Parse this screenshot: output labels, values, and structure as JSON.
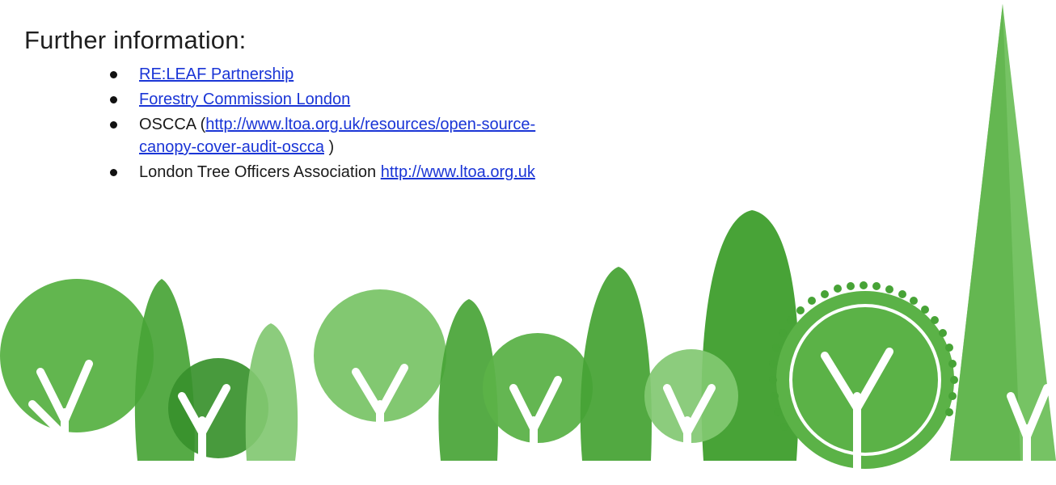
{
  "heading": "Further information:",
  "links": [
    {
      "prefix": "",
      "link": "RE:LEAF Partnership",
      "suffix": ""
    },
    {
      "prefix": "",
      "link": "Forestry Commission London",
      "suffix": ""
    },
    {
      "prefix": "OSCCA (",
      "link": "http://www.ltoa.org.uk/resources/open-source-",
      "link2": "canopy-cover-audit-oscca",
      "suffix": " )"
    },
    {
      "prefix": "London Tree Officers Association ",
      "link": "http://www.ltoa.org.uk",
      "suffix": ""
    }
  ],
  "colors": {
    "tree_dark": "#3e9f2c",
    "tree_mid": "#58b443",
    "tree_light": "#7cc66a",
    "link": "#1a35d6",
    "text": "#1f1f1f"
  }
}
